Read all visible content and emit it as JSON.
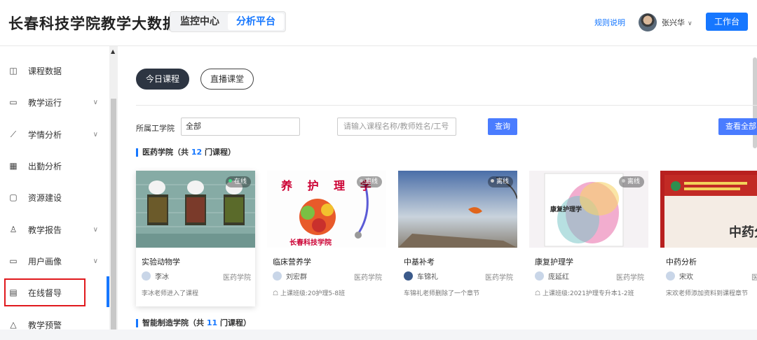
{
  "header": {
    "brand": "长春科技学院教学大数据",
    "tabs": [
      {
        "label": "监控中心"
      },
      {
        "label": "分析平台"
      }
    ],
    "rules_link": "规则说明",
    "user_name": "张兴华",
    "workbench_button": "工作台"
  },
  "sidebar": {
    "items": [
      {
        "label": "课程数据",
        "icon": "book-icon"
      },
      {
        "label": "教学运行",
        "icon": "monitor-icon"
      },
      {
        "label": "学情分析",
        "icon": "line-chart-icon"
      },
      {
        "label": "出勤分析",
        "icon": "calendar-icon"
      },
      {
        "label": "资源建设",
        "icon": "folder-icon"
      },
      {
        "label": "教学报告",
        "icon": "person-icon"
      },
      {
        "label": "用户画像",
        "icon": "monitor-icon"
      },
      {
        "label": "在线督导",
        "icon": "clipboard-icon"
      },
      {
        "label": "教学预警",
        "icon": "bell-icon"
      }
    ]
  },
  "main": {
    "pills": [
      {
        "label": "今日课程"
      },
      {
        "label": "直播课堂"
      }
    ],
    "filter_label": "所属工学院",
    "filter_value": "全部",
    "search_placeholder": "请输入课程名称/教师姓名/工号",
    "query_button": "查询",
    "view_all_button": "查看全部",
    "sections": [
      {
        "prefix": "医药学院（共 ",
        "count": "12",
        "suffix": " 门课程）"
      },
      {
        "prefix": "智能制造学院（共 ",
        "count": "11",
        "suffix": " 门课程）"
      }
    ],
    "cards": [
      {
        "title": "实验动物学",
        "teacher": "李冰",
        "college": "医药学院",
        "status": "在线",
        "note": "李冰老师进入了课程"
      },
      {
        "title": "临床营养学",
        "teacher": "刘宏群",
        "college": "医药学院",
        "status": "离线",
        "note": "上课班级:20护理5-8班",
        "image_text": "养 护 理 学",
        "image_caption": "长春科技学院"
      },
      {
        "title": "中基补考",
        "teacher": "车锦礼",
        "college": "医药学院",
        "status": "离线",
        "note": "车锦礼老师删除了一个章节"
      },
      {
        "title": "康复护理学",
        "teacher": "庞延红",
        "college": "医药学院",
        "status": "离线",
        "note": "上课班级:2021护理专升本1-2班",
        "image_text": "康复护理学"
      },
      {
        "title": "中药分析",
        "teacher": "宋欢",
        "college": "医",
        "status": "",
        "note": "宋欢老师添加资料到课程章节",
        "image_text": "中药分"
      }
    ]
  },
  "colors": {
    "accent": "#1677ff",
    "online": "#3ddc84",
    "highlight": "#e0191d"
  }
}
